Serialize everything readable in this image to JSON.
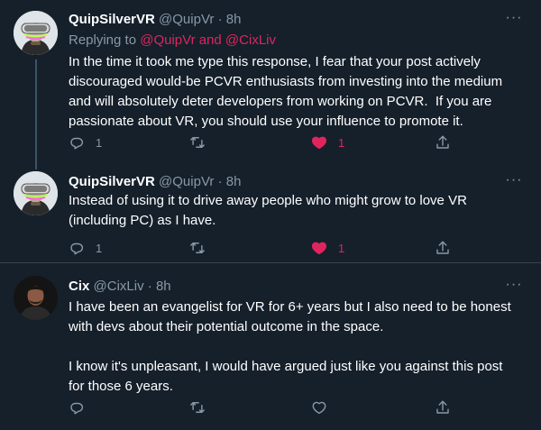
{
  "colors": {
    "background": "#15202b",
    "text_primary": "#ffffff",
    "text_secondary": "#8899a6",
    "like_accent": "#e0245e",
    "divider": "#38444d"
  },
  "tweets": [
    {
      "display_name": "QuipSilverVR",
      "handle": "@QuipVr",
      "separator": "·",
      "time": "8h",
      "more_icon": "more-icon",
      "reply_prefix": "Replying to ",
      "reply_mentions": "@QuipVr and @CixLiv",
      "text": "In the time it took me type this response, I fear that your post actively discouraged would-be PCVR enthusiasts from investing into the medium and will absolutely deter developers from working on PCVR.  If you are passionate about VR, you should use your influence to promote it.",
      "reply_count": "1",
      "retweet_count": "",
      "like_count": "1",
      "liked": true
    },
    {
      "display_name": "QuipSilverVR",
      "handle": "@QuipVr",
      "separator": "·",
      "time": "8h",
      "more_icon": "more-icon",
      "text": "Instead of using it to drive away people who might grow to love VR (including PC) as I have.",
      "reply_count": "1",
      "retweet_count": "",
      "like_count": "1",
      "liked": true
    },
    {
      "display_name": "Cix",
      "handle": "@CixLiv",
      "separator": "·",
      "time": "8h",
      "more_icon": "more-icon",
      "text": "I have been an evangelist for VR for 6+ years but I also need to be honest with devs about their potential outcome in the space.\n\nI know it's unpleasant, I would have argued just like you against this post for those 6 years.",
      "reply_count": "",
      "retweet_count": "",
      "like_count": "",
      "liked": false
    }
  ]
}
